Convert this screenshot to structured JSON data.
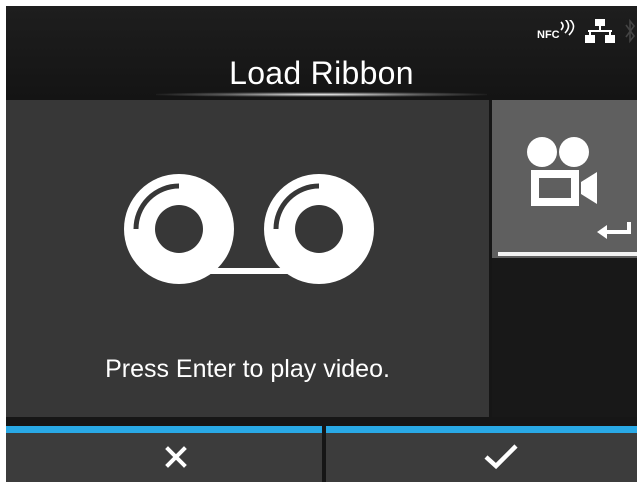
{
  "header": {
    "title": "Load Ribbon",
    "status": {
      "nfc_label": "NFC"
    }
  },
  "main": {
    "prompt": "Press Enter to play video."
  },
  "side": {
    "icon": "video-camera-icon",
    "enter_icon": "enter-arrow-icon"
  },
  "softkeys": {
    "cancel_icon": "close-icon",
    "confirm_icon": "checkmark-icon"
  },
  "colors": {
    "background": "#161616",
    "panel": "#373737",
    "side_button": "#5f5f5f",
    "softkey": "#3c3c3c",
    "accent": "#29a9e6",
    "text": "#ffffff"
  }
}
